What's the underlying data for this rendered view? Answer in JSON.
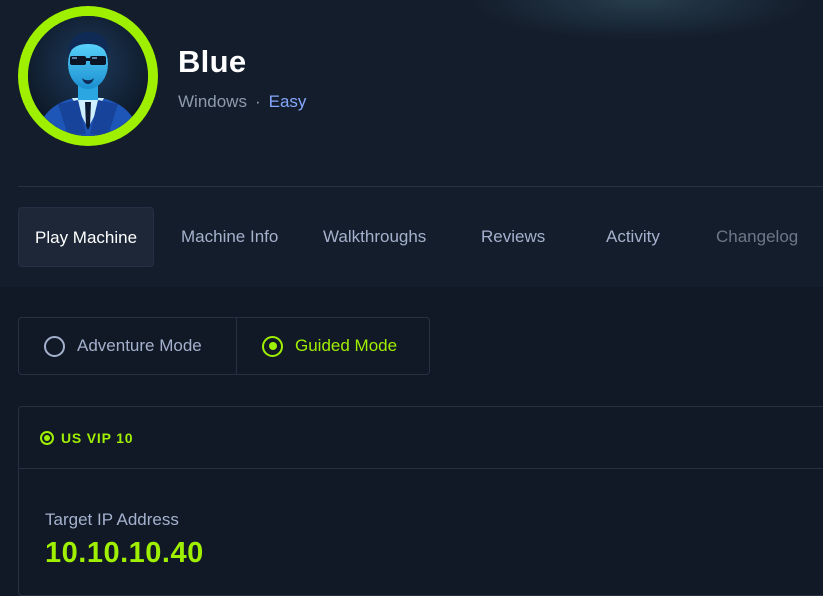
{
  "machine": {
    "name": "Blue",
    "os": "Windows",
    "separator": "·",
    "difficulty": "Easy"
  },
  "tabs": [
    {
      "label": "Play Machine",
      "state": "active"
    },
    {
      "label": "Machine Info",
      "state": "normal"
    },
    {
      "label": "Walkthroughs",
      "state": "normal"
    },
    {
      "label": "Reviews",
      "state": "normal"
    },
    {
      "label": "Activity",
      "state": "normal"
    },
    {
      "label": "Changelog",
      "state": "disabled"
    }
  ],
  "modes": {
    "adventure": {
      "label": "Adventure Mode",
      "selected": false
    },
    "guided": {
      "label": "Guided Mode",
      "selected": true
    }
  },
  "connection": {
    "server": "US VIP 10",
    "status": "online",
    "ip_label": "Target IP Address",
    "ip_value": "10.10.10.40"
  },
  "colors": {
    "accent": "#9fef00",
    "difficulty_easy": "#85a8ff",
    "background": "#111927"
  },
  "icons": {
    "avatar": "agent-avatar",
    "radio_off": "radio-unchecked-icon",
    "radio_on": "radio-checked-icon",
    "status": "online-status-icon"
  }
}
